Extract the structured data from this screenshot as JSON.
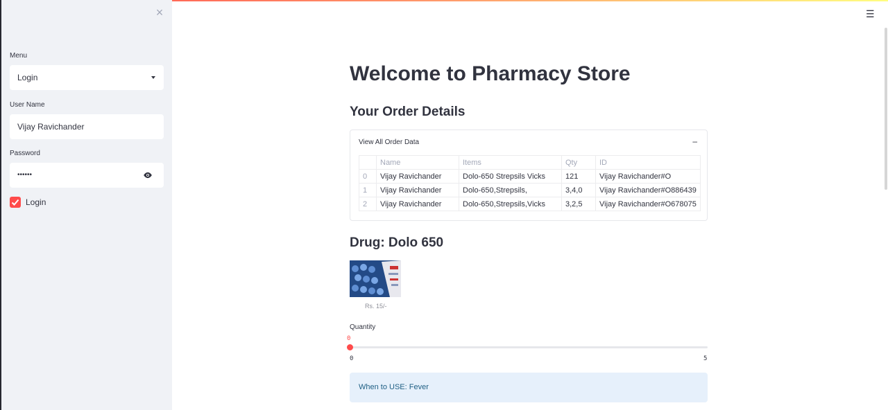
{
  "colors": {
    "accent": "#ff4b4b",
    "sidebar_bg": "#f0f2f6",
    "info_bg": "#e6f0fb",
    "info_text": "#1f5f84"
  },
  "sidebar": {
    "close_icon": "×",
    "menu_label": "Menu",
    "menu_value": "Login",
    "username_label": "User Name",
    "username_value": "Vijay Ravichander",
    "password_label": "Password",
    "password_value": "••••••",
    "checkbox_label": "Login",
    "checkbox_checked": true
  },
  "header": {
    "menu_icon": "☰"
  },
  "main": {
    "title": "Welcome to Pharmacy Store",
    "order_heading": "Your Order Details",
    "expander": {
      "title": "View All Order Data",
      "toggle": "–",
      "columns": [
        "",
        "Name",
        "Items",
        "Qty",
        "ID"
      ],
      "rows": [
        [
          "0",
          "Vijay Ravichander",
          "Dolo-650 Strepsils Vicks",
          "121",
          "Vijay Ravichander#O"
        ],
        [
          "1",
          "Vijay Ravichander",
          "Dolo-650,Strepsils,",
          "3,4,0",
          "Vijay Ravichander#O886439"
        ],
        [
          "2",
          "Vijay Ravichander",
          "Dolo-650,Strepsils,Vicks",
          "3,2,5",
          "Vijay Ravichander#O678075"
        ]
      ]
    },
    "drug_heading": "Drug: Dolo 650",
    "image_caption": "Rs. 15/-",
    "quantity_label": "Quantity",
    "slider": {
      "value": "0",
      "min": "0",
      "max": "5"
    },
    "info_text": "When to USE: Fever"
  }
}
